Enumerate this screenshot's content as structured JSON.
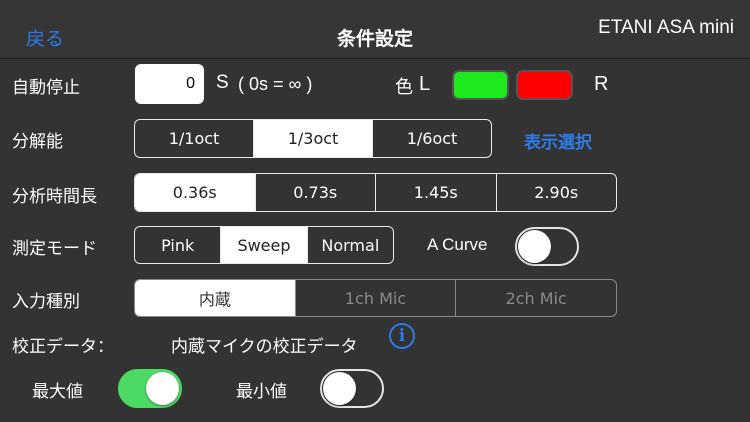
{
  "nav": {
    "back_label": "戻る",
    "title": "条件設定",
    "app_name": "ETANI ASA mini"
  },
  "auto_stop": {
    "label": "自動停止",
    "value": "0",
    "unit": "S",
    "note": "( 0s = ∞ )"
  },
  "color": {
    "label": "色",
    "left_label": "L",
    "right_label": "R",
    "left_color": "#1ee81e",
    "right_color": "#ff0000"
  },
  "resolution": {
    "label": "分解能",
    "options": [
      "1/1oct",
      "1/3oct",
      "1/6oct"
    ],
    "selected_index": 1,
    "display_select_label": "表示選択"
  },
  "analysis_time": {
    "label": "分析時間長",
    "options": [
      "0.36s",
      "0.73s",
      "1.45s",
      "2.90s"
    ],
    "selected_index": 0
  },
  "measure_mode": {
    "label": "測定モード",
    "options": [
      "Pink",
      "Sweep",
      "Normal"
    ],
    "selected_index": 1,
    "a_curve_label": "A Curve",
    "a_curve_on": false
  },
  "input_type": {
    "label": "入力種別",
    "options": [
      "内蔵",
      "1ch Mic",
      "2ch Mic"
    ],
    "selected_index": 0
  },
  "calibration": {
    "label": "校正データ：",
    "value": "内蔵マイクの校正データ",
    "info_icon": "i"
  },
  "max_value": {
    "label": "最大値",
    "on": true
  },
  "min_value": {
    "label": "最小値",
    "on": false
  }
}
